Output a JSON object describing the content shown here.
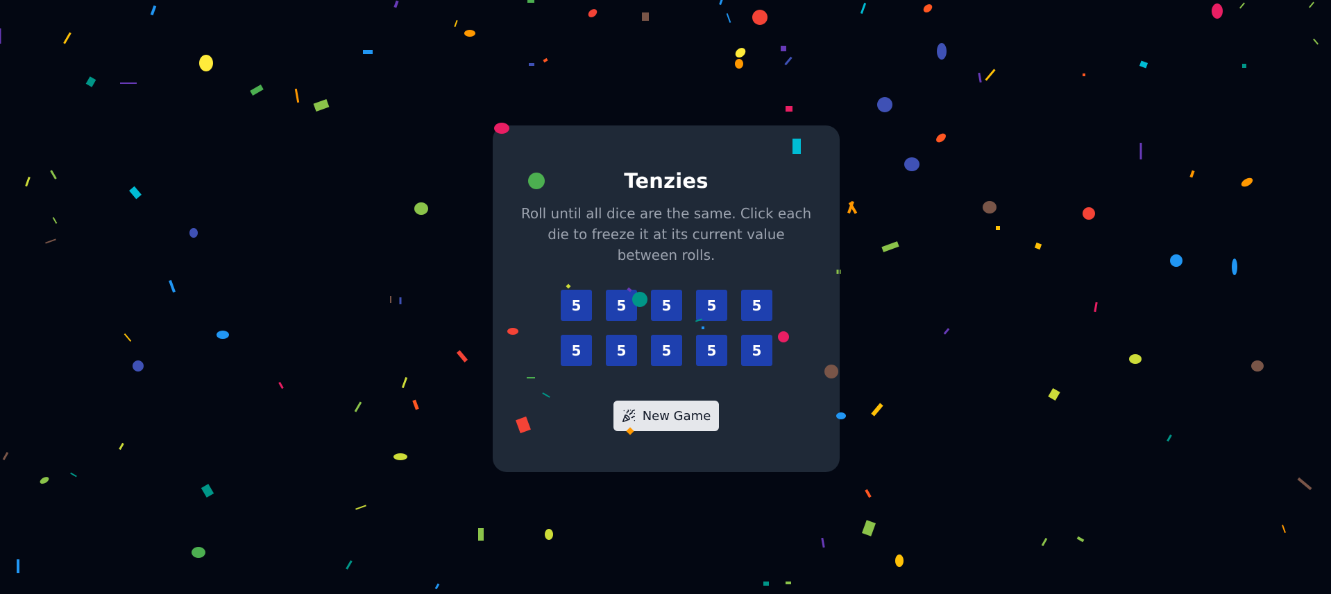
{
  "game": {
    "title": "Tenzies",
    "instructions": "Roll until all dice are the same. Click each die to freeze it at its current value between rolls.",
    "dice": [
      {
        "value": "5",
        "held": true
      },
      {
        "value": "5",
        "held": true
      },
      {
        "value": "5",
        "held": true
      },
      {
        "value": "5",
        "held": true
      },
      {
        "value": "5",
        "held": true
      },
      {
        "value": "5",
        "held": true
      },
      {
        "value": "5",
        "held": true
      },
      {
        "value": "5",
        "held": true
      },
      {
        "value": "5",
        "held": true
      },
      {
        "value": "5",
        "held": true
      }
    ],
    "new_game_label": "New Game",
    "new_game_icon": "party-popper-icon"
  },
  "colors": {
    "background": "#030712",
    "card": "#1f2937",
    "die_held": "#1e40af",
    "title": "#ffffff",
    "instructions": "#9ca3af",
    "button_bg": "#e5e7eb"
  }
}
